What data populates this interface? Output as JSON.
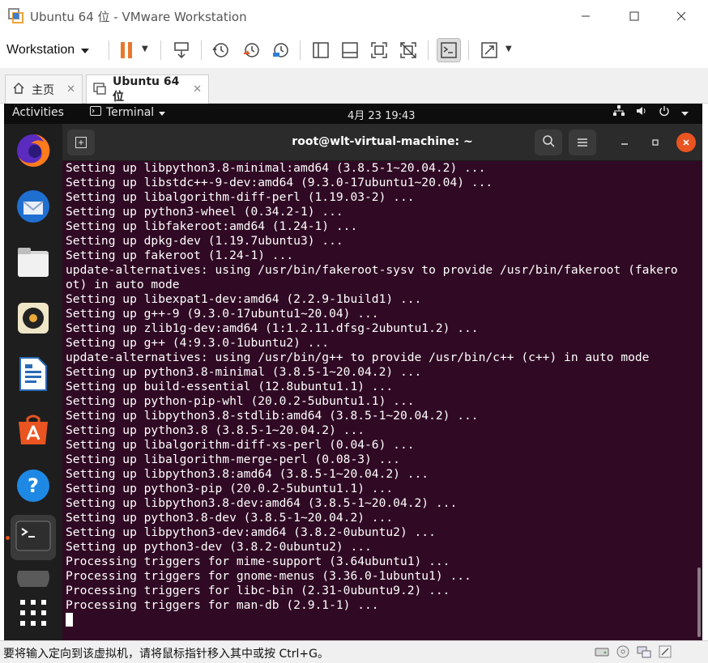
{
  "window": {
    "title": "Ubuntu 64 位 - VMware Workstation"
  },
  "toolbar": {
    "workstation_label": "Workstation"
  },
  "tabs": [
    {
      "label": "主页"
    },
    {
      "label": "Ubuntu 64 位"
    }
  ],
  "topbar": {
    "activities": "Activities",
    "app_menu": "Terminal",
    "clock": "4月 23  19:43"
  },
  "terminal": {
    "title": "root@wlt-virtual-machine: ~",
    "lines": [
      "Setting up libpython3.8-minimal:amd64 (3.8.5-1~20.04.2) ...",
      "Setting up libstdc++-9-dev:amd64 (9.3.0-17ubuntu1~20.04) ...",
      "Setting up libalgorithm-diff-perl (1.19.03-2) ...",
      "Setting up python3-wheel (0.34.2-1) ...",
      "Setting up libfakeroot:amd64 (1.24-1) ...",
      "Setting up dpkg-dev (1.19.7ubuntu3) ...",
      "Setting up fakeroot (1.24-1) ...",
      "update-alternatives: using /usr/bin/fakeroot-sysv to provide /usr/bin/fakeroot (fakero",
      "ot) in auto mode",
      "Setting up libexpat1-dev:amd64 (2.2.9-1build1) ...",
      "Setting up g++-9 (9.3.0-17ubuntu1~20.04) ...",
      "Setting up zlib1g-dev:amd64 (1:1.2.11.dfsg-2ubuntu1.2) ...",
      "Setting up g++ (4:9.3.0-1ubuntu2) ...",
      "update-alternatives: using /usr/bin/g++ to provide /usr/bin/c++ (c++) in auto mode",
      "Setting up python3.8-minimal (3.8.5-1~20.04.2) ...",
      "Setting up build-essential (12.8ubuntu1.1) ...",
      "Setting up python-pip-whl (20.0.2-5ubuntu1.1) ...",
      "Setting up libpython3.8-stdlib:amd64 (3.8.5-1~20.04.2) ...",
      "Setting up python3.8 (3.8.5-1~20.04.2) ...",
      "Setting up libalgorithm-diff-xs-perl (0.04-6) ...",
      "Setting up libalgorithm-merge-perl (0.08-3) ...",
      "Setting up libpython3.8:amd64 (3.8.5-1~20.04.2) ...",
      "Setting up python3-pip (20.0.2-5ubuntu1.1) ...",
      "Setting up libpython3.8-dev:amd64 (3.8.5-1~20.04.2) ...",
      "Setting up python3.8-dev (3.8.5-1~20.04.2) ...",
      "Setting up libpython3-dev:amd64 (3.8.2-0ubuntu2) ...",
      "Setting up python3-dev (3.8.2-0ubuntu2) ...",
      "Processing triggers for mime-support (3.64ubuntu1) ...",
      "Processing triggers for gnome-menus (3.36.0-1ubuntu1) ...",
      "Processing triggers for libc-bin (2.31-0ubuntu9.2) ...",
      "Processing triggers for man-db (2.9.1-1) ..."
    ]
  },
  "statusbar": {
    "text": "要将输入定向到该虚拟机，请将鼠标指针移入其中或按 Ctrl+G。"
  },
  "colors": {
    "terminal_bg": "#300a24",
    "ubuntu_orange": "#e95420",
    "pause_orange": "#e8772e"
  },
  "dock_apps": [
    {
      "icon": "firefox-icon"
    },
    {
      "icon": "thunderbird-icon"
    },
    {
      "icon": "files-icon"
    },
    {
      "icon": "rhythmbox-icon"
    },
    {
      "icon": "libreoffice-writer-icon"
    },
    {
      "icon": "ubuntu-software-icon"
    },
    {
      "icon": "help-icon"
    },
    {
      "icon": "terminal-icon"
    },
    {
      "icon": "show-applications-icon"
    }
  ]
}
